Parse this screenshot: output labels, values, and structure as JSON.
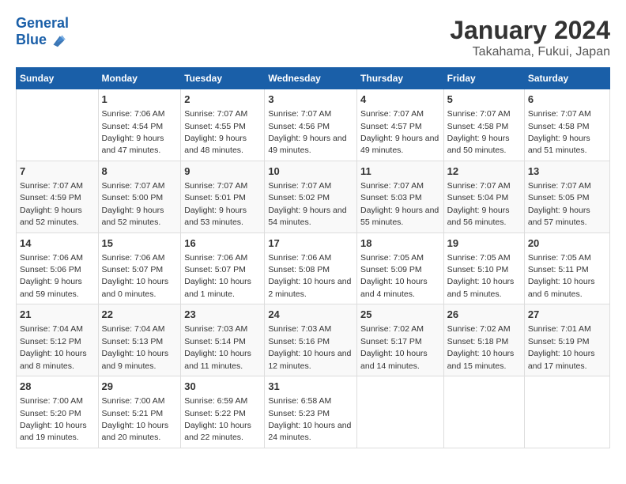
{
  "header": {
    "logo_line1": "General",
    "logo_line2": "Blue",
    "title": "January 2024",
    "subtitle": "Takahama, Fukui, Japan"
  },
  "calendar": {
    "headers": [
      "Sunday",
      "Monday",
      "Tuesday",
      "Wednesday",
      "Thursday",
      "Friday",
      "Saturday"
    ],
    "weeks": [
      [
        {
          "day": "",
          "empty": true
        },
        {
          "day": "1",
          "sunrise": "7:06 AM",
          "sunset": "4:54 PM",
          "daylight": "9 hours and 47 minutes."
        },
        {
          "day": "2",
          "sunrise": "7:07 AM",
          "sunset": "4:55 PM",
          "daylight": "9 hours and 48 minutes."
        },
        {
          "day": "3",
          "sunrise": "7:07 AM",
          "sunset": "4:56 PM",
          "daylight": "9 hours and 49 minutes."
        },
        {
          "day": "4",
          "sunrise": "7:07 AM",
          "sunset": "4:57 PM",
          "daylight": "9 hours and 49 minutes."
        },
        {
          "day": "5",
          "sunrise": "7:07 AM",
          "sunset": "4:58 PM",
          "daylight": "9 hours and 50 minutes."
        },
        {
          "day": "6",
          "sunrise": "7:07 AM",
          "sunset": "4:58 PM",
          "daylight": "9 hours and 51 minutes."
        }
      ],
      [
        {
          "day": "7",
          "sunrise": "7:07 AM",
          "sunset": "4:59 PM",
          "daylight": "9 hours and 52 minutes."
        },
        {
          "day": "8",
          "sunrise": "7:07 AM",
          "sunset": "5:00 PM",
          "daylight": "9 hours and 52 minutes."
        },
        {
          "day": "9",
          "sunrise": "7:07 AM",
          "sunset": "5:01 PM",
          "daylight": "9 hours and 53 minutes."
        },
        {
          "day": "10",
          "sunrise": "7:07 AM",
          "sunset": "5:02 PM",
          "daylight": "9 hours and 54 minutes."
        },
        {
          "day": "11",
          "sunrise": "7:07 AM",
          "sunset": "5:03 PM",
          "daylight": "9 hours and 55 minutes."
        },
        {
          "day": "12",
          "sunrise": "7:07 AM",
          "sunset": "5:04 PM",
          "daylight": "9 hours and 56 minutes."
        },
        {
          "day": "13",
          "sunrise": "7:07 AM",
          "sunset": "5:05 PM",
          "daylight": "9 hours and 57 minutes."
        }
      ],
      [
        {
          "day": "14",
          "sunrise": "7:06 AM",
          "sunset": "5:06 PM",
          "daylight": "9 hours and 59 minutes."
        },
        {
          "day": "15",
          "sunrise": "7:06 AM",
          "sunset": "5:07 PM",
          "daylight": "10 hours and 0 minutes."
        },
        {
          "day": "16",
          "sunrise": "7:06 AM",
          "sunset": "5:07 PM",
          "daylight": "10 hours and 1 minute."
        },
        {
          "day": "17",
          "sunrise": "7:06 AM",
          "sunset": "5:08 PM",
          "daylight": "10 hours and 2 minutes."
        },
        {
          "day": "18",
          "sunrise": "7:05 AM",
          "sunset": "5:09 PM",
          "daylight": "10 hours and 4 minutes."
        },
        {
          "day": "19",
          "sunrise": "7:05 AM",
          "sunset": "5:10 PM",
          "daylight": "10 hours and 5 minutes."
        },
        {
          "day": "20",
          "sunrise": "7:05 AM",
          "sunset": "5:11 PM",
          "daylight": "10 hours and 6 minutes."
        }
      ],
      [
        {
          "day": "21",
          "sunrise": "7:04 AM",
          "sunset": "5:12 PM",
          "daylight": "10 hours and 8 minutes."
        },
        {
          "day": "22",
          "sunrise": "7:04 AM",
          "sunset": "5:13 PM",
          "daylight": "10 hours and 9 minutes."
        },
        {
          "day": "23",
          "sunrise": "7:03 AM",
          "sunset": "5:14 PM",
          "daylight": "10 hours and 11 minutes."
        },
        {
          "day": "24",
          "sunrise": "7:03 AM",
          "sunset": "5:16 PM",
          "daylight": "10 hours and 12 minutes."
        },
        {
          "day": "25",
          "sunrise": "7:02 AM",
          "sunset": "5:17 PM",
          "daylight": "10 hours and 14 minutes."
        },
        {
          "day": "26",
          "sunrise": "7:02 AM",
          "sunset": "5:18 PM",
          "daylight": "10 hours and 15 minutes."
        },
        {
          "day": "27",
          "sunrise": "7:01 AM",
          "sunset": "5:19 PM",
          "daylight": "10 hours and 17 minutes."
        }
      ],
      [
        {
          "day": "28",
          "sunrise": "7:00 AM",
          "sunset": "5:20 PM",
          "daylight": "10 hours and 19 minutes."
        },
        {
          "day": "29",
          "sunrise": "7:00 AM",
          "sunset": "5:21 PM",
          "daylight": "10 hours and 20 minutes."
        },
        {
          "day": "30",
          "sunrise": "6:59 AM",
          "sunset": "5:22 PM",
          "daylight": "10 hours and 22 minutes."
        },
        {
          "day": "31",
          "sunrise": "6:58 AM",
          "sunset": "5:23 PM",
          "daylight": "10 hours and 24 minutes."
        },
        {
          "day": "",
          "empty": true
        },
        {
          "day": "",
          "empty": true
        },
        {
          "day": "",
          "empty": true
        }
      ]
    ]
  }
}
